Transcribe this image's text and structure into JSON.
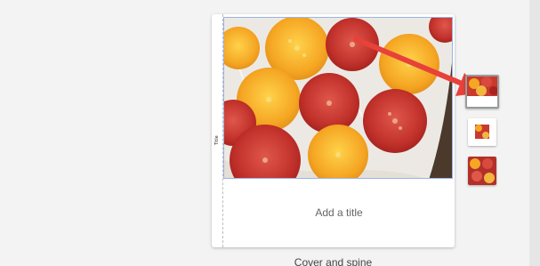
{
  "book": {
    "spine_text": "Title",
    "cover_photo_icon": "tomato-pizza-photo",
    "title_placeholder": "Add a title"
  },
  "caption": "Cover and spine",
  "thumbnails": [
    {
      "label": "cover-layout-1",
      "selected": true
    },
    {
      "label": "cover-layout-2",
      "selected": false
    },
    {
      "label": "cover-layout-3",
      "selected": false
    }
  ],
  "colors": {
    "accent_arrow": "#e8413a",
    "selection_outline": "#9bb3e8",
    "tomato_red": "#c9302c",
    "tomato_yellow": "#f4b12a"
  }
}
